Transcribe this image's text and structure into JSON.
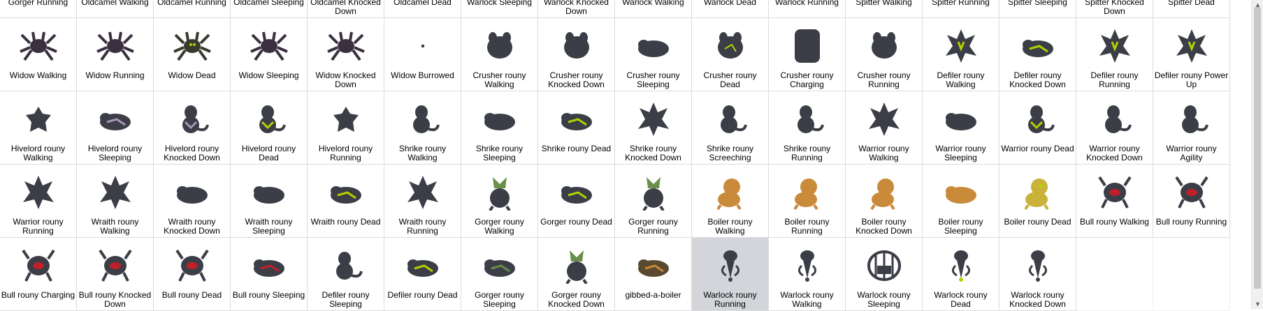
{
  "colors": {
    "selected_bg": "#d3d5da",
    "grid_line": "#dcdcdc",
    "sprite_dark": "#3a3d45"
  },
  "items": [
    {
      "label": "Gorger Running",
      "sprite": "gorger",
      "color": "#3b3e46"
    },
    {
      "label": "Oldcamel Walking",
      "sprite": "insect",
      "color": "#3b3e46"
    },
    {
      "label": "Oldcamel Running",
      "sprite": "insect",
      "color": "#3b3e46"
    },
    {
      "label": "Oldcamel Sleeping",
      "sprite": "insect",
      "color": "#3b3e46"
    },
    {
      "label": "Oldcamel Knocked Down",
      "sprite": "insect",
      "color": "#3b3e46"
    },
    {
      "label": "Oldcamel Dead",
      "sprite": "insect",
      "color": "#3b3e46"
    },
    {
      "label": "Warlock Sleeping",
      "sprite": "blob",
      "color": "#3b3e46"
    },
    {
      "label": "Warlock Knocked Down",
      "sprite": "blob",
      "color": "#3b3e46"
    },
    {
      "label": "Warlock Walking",
      "sprite": "blob",
      "color": "#3b3e46"
    },
    {
      "label": "Warlock Dead",
      "sprite": "blob",
      "color": "#3b3e46"
    },
    {
      "label": "Warlock Running",
      "sprite": "blob",
      "color": "#3b3e46"
    },
    {
      "label": "Spitter Walking",
      "sprite": "blob",
      "color": "#3b3e46"
    },
    {
      "label": "Spitter Running",
      "sprite": "blob",
      "color": "#3b3e46"
    },
    {
      "label": "Spitter Sleeping",
      "sprite": "blob",
      "color": "#3b3e46"
    },
    {
      "label": "Spitter Knocked Down",
      "sprite": "blob",
      "color": "#3b3e46"
    },
    {
      "label": "Spitter Dead",
      "sprite": "blob",
      "color": "#3b3e46"
    },
    {
      "label": "Widow Walking",
      "sprite": "spider",
      "color": "#3a3040"
    },
    {
      "label": "Widow Running",
      "sprite": "spider",
      "color": "#3a3040"
    },
    {
      "label": "Widow Dead",
      "sprite": "spider",
      "color": "#3a3a30",
      "accent": "#b5d000"
    },
    {
      "label": "Widow Sleeping",
      "sprite": "spider",
      "color": "#3a3040"
    },
    {
      "label": "Widow Knocked Down",
      "sprite": "spider",
      "color": "#3a3040"
    },
    {
      "label": "Widow Burrowed",
      "sprite": "dot",
      "color": "#444"
    },
    {
      "label": "Crusher rouny Walking",
      "sprite": "blob",
      "color": "#3b3e46"
    },
    {
      "label": "Crusher rouny Knocked Down",
      "sprite": "blob",
      "color": "#3b3e46"
    },
    {
      "label": "Crusher rouny Sleeping",
      "sprite": "lump",
      "color": "#3b3e46"
    },
    {
      "label": "Crusher rouny Dead",
      "sprite": "blob",
      "color": "#3b3e46",
      "accent": "#b5d000"
    },
    {
      "label": "Crusher rouny Charging",
      "sprite": "block",
      "color": "#3b3e46"
    },
    {
      "label": "Crusher rouny Running",
      "sprite": "blob",
      "color": "#3b3e46"
    },
    {
      "label": "Defiler rouny Walking",
      "sprite": "spiky",
      "color": "#3b3e46",
      "accent": "#b5d000"
    },
    {
      "label": "Defiler rouny Knocked Down",
      "sprite": "lump",
      "color": "#3b3e46",
      "accent": "#b5d000"
    },
    {
      "label": "Defiler rouny Running",
      "sprite": "spiky",
      "color": "#3b3e46",
      "accent": "#b5d000"
    },
    {
      "label": "Defiler rouny Power Up",
      "sprite": "spiky",
      "color": "#3b3e46",
      "accent": "#b5d000"
    },
    {
      "label": "Hivelord rouny Walking",
      "sprite": "star",
      "color": "#3b3e46"
    },
    {
      "label": "Hivelord rouny Sleeping",
      "sprite": "lump",
      "color": "#3b3e46",
      "accent": "#a896b8"
    },
    {
      "label": "Hivelord rouny Knocked Down",
      "sprite": "creature",
      "color": "#3b3e46",
      "accent": "#a896b8"
    },
    {
      "label": "Hivelord rouny Dead",
      "sprite": "creature",
      "color": "#3b3e46",
      "accent": "#b5d000"
    },
    {
      "label": "Hivelord rouny Running",
      "sprite": "star",
      "color": "#3b3e46"
    },
    {
      "label": "Shrike rouny Walking",
      "sprite": "creature",
      "color": "#3b3e46"
    },
    {
      "label": "Shrike rouny Sleeping",
      "sprite": "lump",
      "color": "#3b3e46"
    },
    {
      "label": "Shrike rouny Dead",
      "sprite": "lump",
      "color": "#3b3e46",
      "accent": "#b5d000"
    },
    {
      "label": "Shrike rouny Knocked Down",
      "sprite": "spiky",
      "color": "#3b3e46"
    },
    {
      "label": "Shrike rouny Screeching",
      "sprite": "creature",
      "color": "#3b3e46"
    },
    {
      "label": "Shrike rouny Running",
      "sprite": "creature",
      "color": "#3b3e46"
    },
    {
      "label": "Warrior rouny Walking",
      "sprite": "spiky",
      "color": "#3b3e46"
    },
    {
      "label": "Warrior rouny Sleeping",
      "sprite": "lump",
      "color": "#3b3e46"
    },
    {
      "label": "Warrior rouny Dead",
      "sprite": "creature",
      "color": "#3b3e46",
      "accent": "#b5d000"
    },
    {
      "label": "Warrior rouny Knocked Down",
      "sprite": "creature",
      "color": "#3b3e46"
    },
    {
      "label": "Warrior rouny Agility",
      "sprite": "creature",
      "color": "#3b3e46"
    },
    {
      "label": "Warrior rouny Running",
      "sprite": "spiky",
      "color": "#3b3e46"
    },
    {
      "label": "Wraith rouny Walking",
      "sprite": "spiky",
      "color": "#3b3e46"
    },
    {
      "label": "Wraith rouny Knocked Down",
      "sprite": "lump",
      "color": "#3b3e46"
    },
    {
      "label": "Wraith rouny Sleeping",
      "sprite": "lump",
      "color": "#3b3e46"
    },
    {
      "label": "Wraith rouny Dead",
      "sprite": "lump",
      "color": "#3b3e46",
      "accent": "#b5d000"
    },
    {
      "label": "Wraith rouny Running",
      "sprite": "spiky",
      "color": "#3b3e46"
    },
    {
      "label": "Gorger rouny Walking",
      "sprite": "gorger",
      "color": "#3b3e46",
      "accent": "#6a8f4a"
    },
    {
      "label": "Gorger rouny Dead",
      "sprite": "lump",
      "color": "#3b3e46",
      "accent": "#b5d000"
    },
    {
      "label": "Gorger rouny Running",
      "sprite": "gorger",
      "color": "#3b3e46",
      "accent": "#6a8f4a"
    },
    {
      "label": "Boiler rouny Walking",
      "sprite": "boiler",
      "color": "#c98a3a"
    },
    {
      "label": "Boiler rouny Running",
      "sprite": "boiler",
      "color": "#c98a3a"
    },
    {
      "label": "Boiler rouny Knocked Down",
      "sprite": "boiler",
      "color": "#c98a3a"
    },
    {
      "label": "Boiler rouny Sleeping",
      "sprite": "lump",
      "color": "#c98a3a"
    },
    {
      "label": "Boiler rouny Dead",
      "sprite": "boiler",
      "color": "#c9b23a",
      "accent": "#b5d000"
    },
    {
      "label": "Bull rouny Walking",
      "sprite": "bull",
      "color": "#3b3e46",
      "accent": "#c0202a"
    },
    {
      "label": "Bull rouny Running",
      "sprite": "bull",
      "color": "#3b3e46",
      "accent": "#c0202a"
    },
    {
      "label": "Bull rouny Charging",
      "sprite": "bull",
      "color": "#3b3e46",
      "accent": "#c0202a"
    },
    {
      "label": "Bull rouny Knocked Down",
      "sprite": "bull",
      "color": "#3b3e46",
      "accent": "#c0202a"
    },
    {
      "label": "Bull rouny Dead",
      "sprite": "bull",
      "color": "#3b3e46",
      "accent": "#c0202a"
    },
    {
      "label": "Bull rouny Sleeping",
      "sprite": "lump",
      "color": "#3b3e46",
      "accent": "#c0202a"
    },
    {
      "label": "Defiler rouny Sleeping",
      "sprite": "creature",
      "color": "#3b3e46"
    },
    {
      "label": "Defiler rouny Dead",
      "sprite": "lump",
      "color": "#3b3e46",
      "accent": "#b5d000"
    },
    {
      "label": "Gorger rouny Sleeping",
      "sprite": "lump",
      "color": "#3b3e46",
      "accent": "#6a8f4a"
    },
    {
      "label": "Gorger rouny Knocked Down",
      "sprite": "gorger",
      "color": "#3b3e46",
      "accent": "#6a8f4a"
    },
    {
      "label": "gibbed-a-boiler",
      "sprite": "lump",
      "color": "#5a4a30",
      "accent": "#c98a3a"
    },
    {
      "label": "Warlock rouny Running",
      "sprite": "warlock",
      "color": "#3b3e46",
      "selected": true
    },
    {
      "label": "Warlock rouny Walking",
      "sprite": "warlock",
      "color": "#3b3e46"
    },
    {
      "label": "Warlock rouny Sleeping",
      "sprite": "cage",
      "color": "#3b3e46"
    },
    {
      "label": "Warlock rouny Dead",
      "sprite": "warlock",
      "color": "#3b3e46",
      "accent": "#b5d000"
    },
    {
      "label": "Warlock rouny Knocked Down",
      "sprite": "warlock",
      "color": "#3b3e46"
    },
    {
      "label": "",
      "sprite": "none",
      "color": "#ffffff"
    },
    {
      "label": "",
      "sprite": "none",
      "color": "#ffffff"
    }
  ]
}
